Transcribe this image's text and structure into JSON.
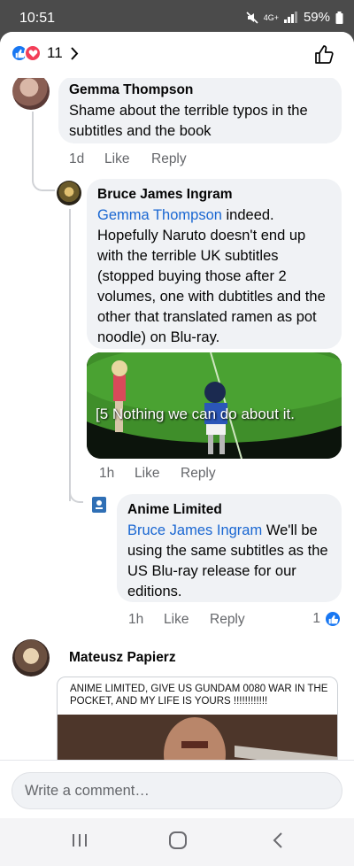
{
  "status": {
    "time": "10:51",
    "network": "4G+",
    "battery": "59%"
  },
  "header": {
    "reaction_count": "11"
  },
  "comments": [
    {
      "author": "Gemma Thompson",
      "text": "Shame about the terrible typos in the subtitles and the book",
      "age": "1d",
      "like": "Like",
      "reply": "Reply"
    },
    {
      "author": "Bruce James Ingram",
      "mention": "Gemma Thompson",
      "text": " indeed. Hopefully Naruto doesn't end up with the terrible UK subtitles (stopped buying those after 2 volumes, one with dubtitles and the other that translated ramen as pot noodle) on Blu-ray.",
      "image_caption": "[5 Nothing we can do about it.",
      "age": "1h",
      "like": "Like",
      "reply": "Reply"
    },
    {
      "author": "Anime Limited",
      "mention": "Bruce James Ingram",
      "text": " We'll be using the same subtitles as the US Blu-ray release for our editions.",
      "age": "1h",
      "like": "Like",
      "reply": "Reply",
      "reaction_count": "1"
    },
    {
      "author": "Mateusz Papierz",
      "image_caption": "ANIME LIMITED, GIVE US GUNDAM 0080 WAR IN THE POCKET, AND MY LIFE IS YOURS !!!!!!!!!!!!"
    }
  ],
  "composer": {
    "placeholder": "Write a comment…"
  },
  "colors": {
    "accent": "#1877f2",
    "mention": "#1a67d2",
    "bubble": "#f0f2f5",
    "love": "#f33e58"
  },
  "icons": [
    "thumbs-up-icon",
    "heart-icon",
    "chevron-right-icon",
    "recents-icon",
    "home-icon",
    "back-icon"
  ]
}
